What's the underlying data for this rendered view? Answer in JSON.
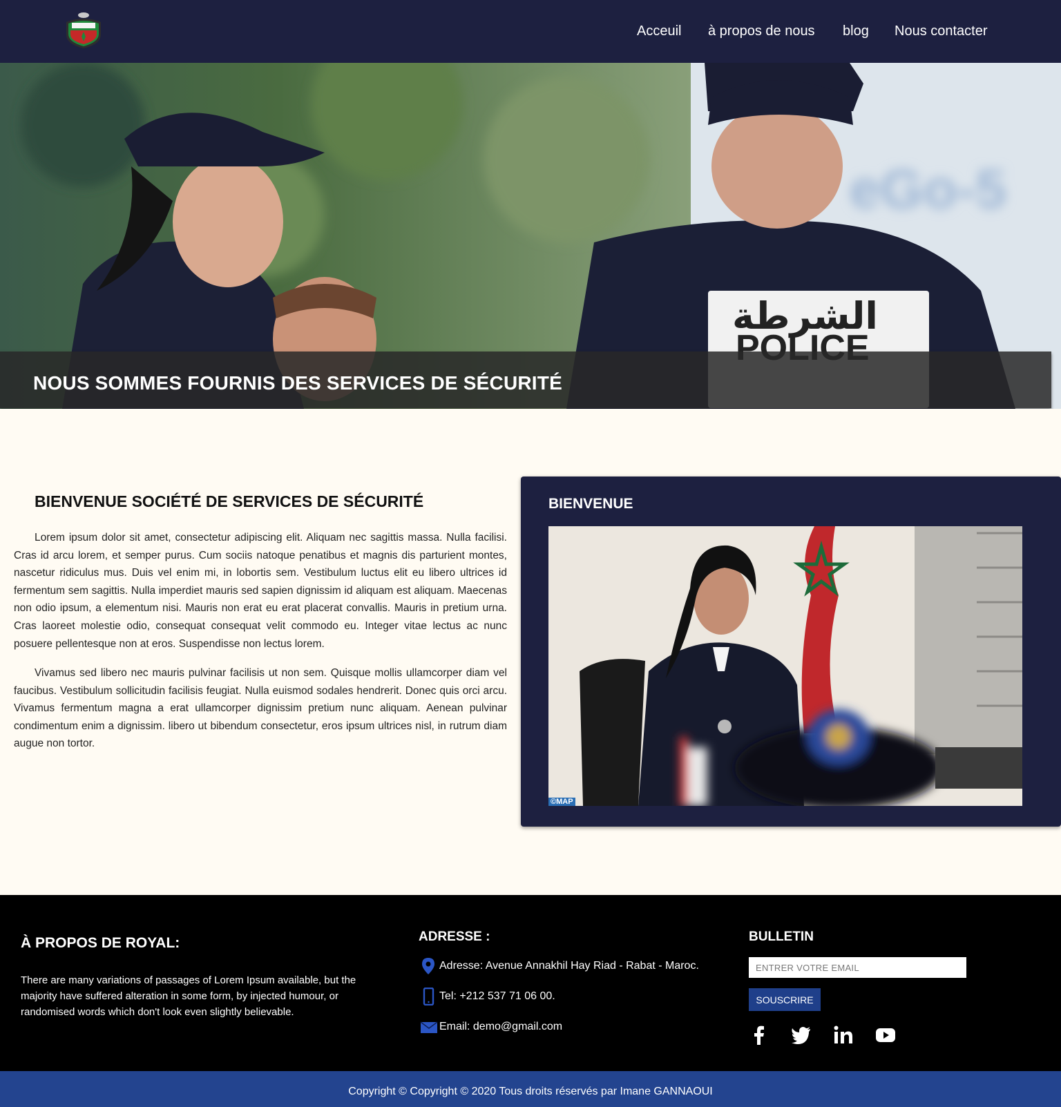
{
  "header": {
    "logo_name": "police-emblem",
    "nav": [
      "Acceuil",
      "à propos de nous",
      "blog",
      "Nous contacter"
    ]
  },
  "hero": {
    "title": "NOUS SOMMES FOURNIS DES SERVICES DE SÉCURITÉ",
    "jacket_patch_arabic": "الشرطة",
    "jacket_patch_latin": "POLICE"
  },
  "welcome": {
    "title": "BIENVENUE SOCIÉTÉ DE SERVICES DE SÉCURITÉ",
    "paragraphs": [
      "Lorem ipsum dolor sit amet, consectetur adipiscing elit. Aliquam nec sagittis massa. Nulla facilisi. Cras id arcu lorem, et semper purus. Cum sociis natoque penatibus et magnis dis parturient montes, nascetur ridiculus mus. Duis vel enim mi, in lobortis sem. Vestibulum luctus elit eu libero ultrices id fermentum sem sagittis. Nulla imperdiet mauris sed sapien dignissim id aliquam est aliquam. Maecenas non odio ipsum, a elementum nisi. Mauris non erat eu erat placerat convallis. Mauris in pretium urna. Cras laoreet molestie odio, consequat consequat velit commodo eu. Integer vitae lectus ac nunc posuere pellentesque non at eros. Suspendisse non lectus lorem.",
      "Vivamus sed libero nec mauris pulvinar facilisis ut non sem. Quisque mollis ullamcorper diam vel faucibus. Vestibulum sollicitudin facilisis feugiat. Nulla euismod sodales hendrerit. Donec quis orci arcu. Vivamus fermentum magna a erat ullamcorper dignissim pretium nunc aliquam. Aenean pulvinar condimentum enim a dignissim. libero ut bibendum consectetur, eros ipsum ultrices nisl, in rutrum diam augue non tortor."
    ],
    "card_title": "BIENVENUE",
    "photo_tag": "©MAP"
  },
  "footer": {
    "about_title": "À PROPOS DE ROYAL:",
    "about_text": "There are many variations of passages of Lorem Ipsum available, but the majority have suffered alteration in some form, by injected humour, or randomised words which don't look even slightly believable.",
    "address_title": "ADRESSE :",
    "address": "Adresse: Avenue Annakhil Hay Riad - Rabat - Maroc.",
    "phone": "Tel: +212 537 71 06 00.",
    "email": "Email: demo@gmail.com",
    "newsletter_title": "BULLETIN",
    "email_placeholder": "ENTRER VOTRE EMAIL",
    "subscribe_label": "SOUSCRIRE",
    "socials": [
      "facebook-icon",
      "twitter-icon",
      "linkedin-icon",
      "youtube-icon"
    ]
  },
  "copyright": "Copyright © Copyright © 2020 Tous droits réservés par Imane GANNAOUI",
  "colors": {
    "navy": "#1d2040",
    "footer_bg": "#000000",
    "accent_blue": "#23448f",
    "page_bg": "#fffbf3"
  }
}
